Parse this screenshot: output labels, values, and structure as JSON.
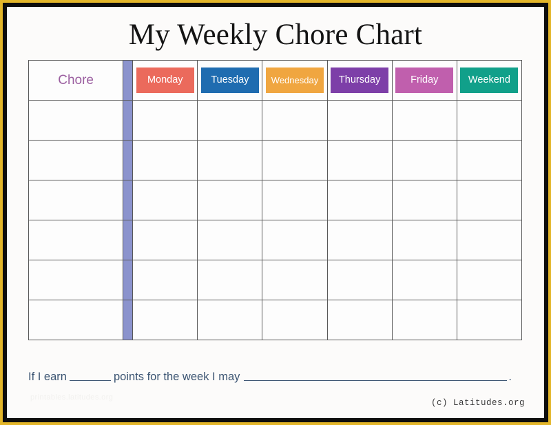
{
  "document": {
    "title": "My Weekly Chore Chart",
    "copyright": "(c) Latitudes.org",
    "watermark": "printables.latitudes.org"
  },
  "frame": {
    "outer_color": "#e3b62a",
    "inner_color": "#0d0d0d",
    "page_color": "#fcfbfa"
  },
  "table": {
    "chore_column": {
      "label": "Chore",
      "label_color": "#9b5fa0"
    },
    "divider_color": "#8b93cd",
    "grid_color": "#595959",
    "row_count": 6,
    "days": [
      {
        "label": "Monday",
        "color": "#eb6a5c"
      },
      {
        "label": "Tuesday",
        "color": "#1f6cb0"
      },
      {
        "label": "Wednesday",
        "color": "#f0a640"
      },
      {
        "label": "Thursday",
        "color": "#7d3fa8"
      },
      {
        "label": "Friday",
        "color": "#c05fad"
      },
      {
        "label": "Weekend",
        "color": "#11a08a"
      }
    ],
    "blank_rows": [
      {
        "chore": "",
        "monday": "",
        "tuesday": "",
        "wednesday": "",
        "thursday": "",
        "friday": "",
        "weekend": ""
      },
      {
        "chore": "",
        "monday": "",
        "tuesday": "",
        "wednesday": "",
        "thursday": "",
        "friday": "",
        "weekend": ""
      },
      {
        "chore": "",
        "monday": "",
        "tuesday": "",
        "wednesday": "",
        "thursday": "",
        "friday": "",
        "weekend": ""
      },
      {
        "chore": "",
        "monday": "",
        "tuesday": "",
        "wednesday": "",
        "thursday": "",
        "friday": "",
        "weekend": ""
      },
      {
        "chore": "",
        "monday": "",
        "tuesday": "",
        "wednesday": "",
        "thursday": "",
        "friday": "",
        "weekend": ""
      },
      {
        "chore": "",
        "monday": "",
        "tuesday": "",
        "wednesday": "",
        "thursday": "",
        "friday": "",
        "weekend": ""
      }
    ]
  },
  "footer": {
    "text_before": "If I earn",
    "text_middle": "points for the week I may",
    "text_end": ".",
    "points_value": "",
    "reward_value": "",
    "text_color": "#3b5472"
  }
}
